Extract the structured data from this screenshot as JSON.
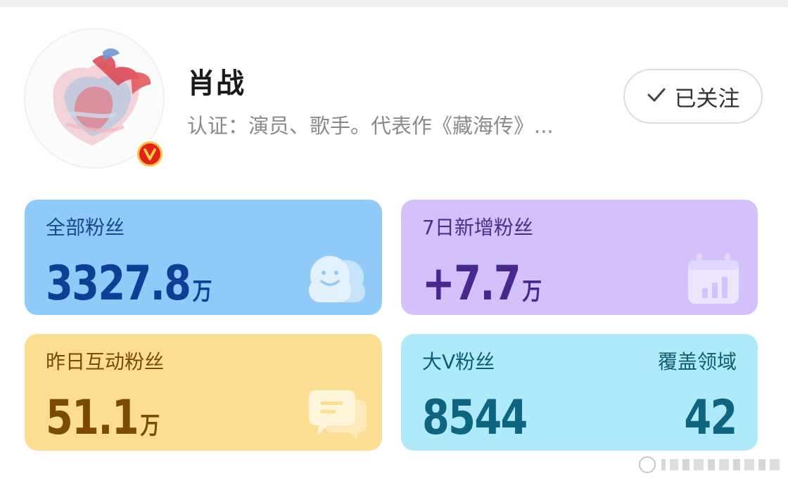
{
  "profile": {
    "name": "肖战",
    "certification": "认证：演员、歌手。代表作《藏海传》...",
    "follow_label": "已关注",
    "avatar_icon": "heart-art-avatar",
    "badge_icon": "verified-v-badge"
  },
  "cards": {
    "total_fans": {
      "title": "全部粉丝",
      "value": "3327.8",
      "unit": "万",
      "icon": "fans-faces-icon"
    },
    "new_fans_7d": {
      "title": "7日新增粉丝",
      "value": "+7.7",
      "unit": "万",
      "icon": "calendar-bar-chart-icon"
    },
    "interactive_fans_yesterday": {
      "title": "昨日互动粉丝",
      "value": "51.1",
      "unit": "万",
      "icon": "chat-bubble-icon"
    },
    "big_v_fans": {
      "title": "大V粉丝",
      "value": "8544",
      "coverage_title": "覆盖领域",
      "coverage_value": "42"
    }
  },
  "colors": {
    "card_blue": "#8fcaf8",
    "card_purple": "#d2c1fb",
    "card_yellow": "#fcde92",
    "card_cyan": "#aeeafa",
    "verified_badge": "#e2231a"
  }
}
